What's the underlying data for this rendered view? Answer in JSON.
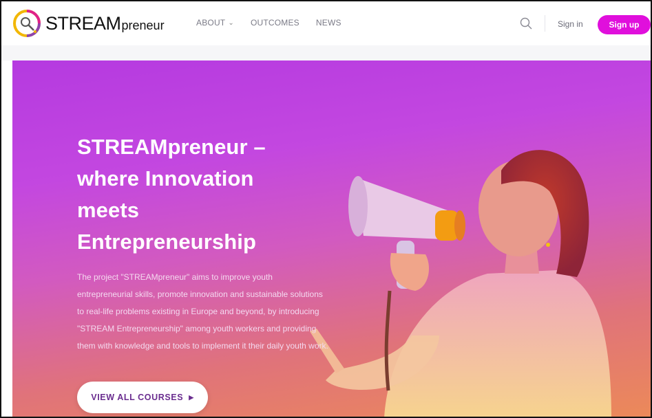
{
  "header": {
    "brand_main": "STREAM",
    "brand_sub": "preneur",
    "nav": [
      {
        "label": "ABOUT",
        "has_dropdown": true
      },
      {
        "label": "OUTCOMES",
        "has_dropdown": false
      },
      {
        "label": "NEWS",
        "has_dropdown": false
      }
    ],
    "search_icon": "search-icon",
    "signin_label": "Sign in",
    "signup_label": "Sign up"
  },
  "hero": {
    "title_lines": [
      "STREAMpreneur –",
      "where Innovation",
      "meets",
      "Entrepreneurship"
    ],
    "description": "The project \"STREAMpreneur\" aims to improve youth entrepreneurial skills, promote innovation and sustainable solutions to real-life problems existing in Europe and beyond, by introducing \"STREAM Entrepreneurship\" among youth workers and providing them with knowledge and tools to implement it their daily youth work.",
    "cta_label": "VIEW ALL COURSES",
    "cta_icon": "triangle-right-icon",
    "image": "woman-with-megaphone"
  },
  "colors": {
    "accent": "#e00fdc",
    "hero_top": "#b53ae0",
    "hero_bottom": "#ec8a58"
  }
}
